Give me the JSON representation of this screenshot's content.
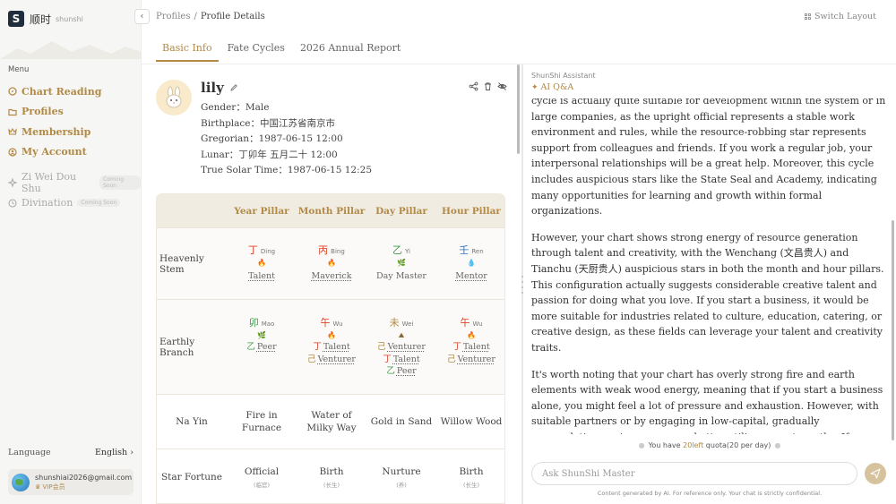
{
  "brand": {
    "name_cn": "顺时",
    "name_en": "shunshi",
    "logo_letter": "S"
  },
  "sidebar": {
    "menu_title": "Menu",
    "items": [
      {
        "label": "Chart Reading",
        "icon": "compass-icon"
      },
      {
        "label": "Profiles",
        "icon": "folder-icon"
      },
      {
        "label": "Membership",
        "icon": "crown-icon"
      },
      {
        "label": "My Account",
        "icon": "user-icon"
      }
    ],
    "secondary": [
      {
        "label": "Zi Wei Dou Shu",
        "badge": "Coming Soon",
        "icon": "star-icon"
      },
      {
        "label": "Divination",
        "badge": "Coming Soon",
        "icon": "clock-icon"
      }
    ],
    "language_label": "Language",
    "language_value": "English",
    "user_email": "shunshiai2026@gmail.com",
    "user_vip": "VIP会员"
  },
  "topbar": {
    "breadcrumb_root": "Profiles",
    "breadcrumb_sep": "/",
    "breadcrumb_current": "Profile Details",
    "switch_layout": "Switch Layout"
  },
  "tabs": [
    "Basic Info",
    "Fate Cycles",
    "2026 Annual Report"
  ],
  "profile": {
    "name": "lily",
    "gender": "Gender：Male",
    "birthplace": "Birthplace：中国江苏省南京市",
    "gregorian": "Gregorian：1987-06-15 12:00",
    "lunar": "Lunar：丁卯年 五月二十 12:00",
    "solar": "True Solar Time：1987-06-15 12:25"
  },
  "pillars": {
    "headers": [
      "Year Pillar",
      "Month Pillar",
      "Day Pillar",
      "Hour Pillar"
    ],
    "stem_label": "Heavenly Stem",
    "stems": [
      {
        "char": "丁",
        "pinyin": "Ding",
        "element": "🔥",
        "god": "Talent"
      },
      {
        "char": "丙",
        "pinyin": "Bing",
        "element": "🔥",
        "god": "Maverick"
      },
      {
        "char": "乙",
        "pinyin": "Yi",
        "element": "🌿",
        "god": "Day Master"
      },
      {
        "char": "壬",
        "pinyin": "Ren",
        "element": "💧",
        "god": "Mentor"
      }
    ],
    "branch_label": "Earthly Branch",
    "branches": [
      {
        "char": "卯",
        "pinyin": "Mao",
        "element": "🌿",
        "hidden": [
          {
            "char": "乙",
            "god": "Peer"
          }
        ]
      },
      {
        "char": "午",
        "pinyin": "Wu",
        "element": "🔥",
        "hidden": [
          {
            "char": "丁",
            "god": "Talent"
          },
          {
            "char": "己",
            "god": "Venturer"
          }
        ]
      },
      {
        "char": "未",
        "pinyin": "Wei",
        "element": "⛰",
        "hidden": [
          {
            "char": "己",
            "god": "Venturer"
          },
          {
            "char": "丁",
            "god": "Talent"
          },
          {
            "char": "乙",
            "god": "Peer"
          }
        ]
      },
      {
        "char": "午",
        "pinyin": "Wu",
        "element": "🔥",
        "hidden": [
          {
            "char": "丁",
            "god": "Talent"
          },
          {
            "char": "己",
            "god": "Venturer"
          }
        ]
      }
    ],
    "nayin_label": "Na Yin",
    "nayin": [
      "Fire in Furnace",
      "Water of Milky Way",
      "Gold in Sand",
      "Willow Wood"
    ],
    "star_label": "Star Fortune",
    "stars": [
      {
        "main": "Official",
        "sub": "(临官)"
      },
      {
        "main": "Birth",
        "sub": "(长生)"
      },
      {
        "main": "Nurture",
        "sub": "(养)"
      },
      {
        "main": "Birth",
        "sub": "(长生)"
      }
    ]
  },
  "assistant": {
    "header": "ShunShi Assistant",
    "tag": "AI Q&A",
    "paragraphs": [
      "cycle is actually quite suitable for development within the system or in large companies, as the upright official represents a stable work environment and rules, while the resource-robbing star represents support from colleagues and friends. If you work a regular job, your interpersonal relationships will be a great help. Moreover, this cycle includes auspicious stars like the State Seal and Academy, indicating many opportunities for learning and growth within formal organizations.",
      "However, your chart shows strong energy of resource generation through talent and creativity, with the Wenchang (文昌贵人) and Tianchu (天厨贵人) auspicious stars in both the month and hour pillars. This configuration actually suggests considerable creative talent and passion for doing what you love. If you start a business, it would be more suitable for industries related to culture, education, catering, or creative design, as these fields can leverage your talent and creativity traits.",
      "It's worth noting that your chart has overly strong fire and earth elements with weak wood energy, meaning that if you start a business alone, you might feel a lot of pressure and exhaustion. However, with suitable partners or by engaging in low-capital, gradually accumulating ventures, you can better utilize your strengths. If you want to explore more specific directions, feel free to ask anytime."
    ],
    "quota_prefix": "You have",
    "quota_num": "20left",
    "quota_suffix": "quota(20 per day)",
    "input_placeholder": "Ask ShunShi Master",
    "disclaimer": "Content generated by AI. For reference only. Your chat is strictly confidential."
  },
  "colors": {
    "accent": "#b28a45",
    "sidebar_bg": "#f6f6f4",
    "table_bg": "#f7f5f1"
  }
}
